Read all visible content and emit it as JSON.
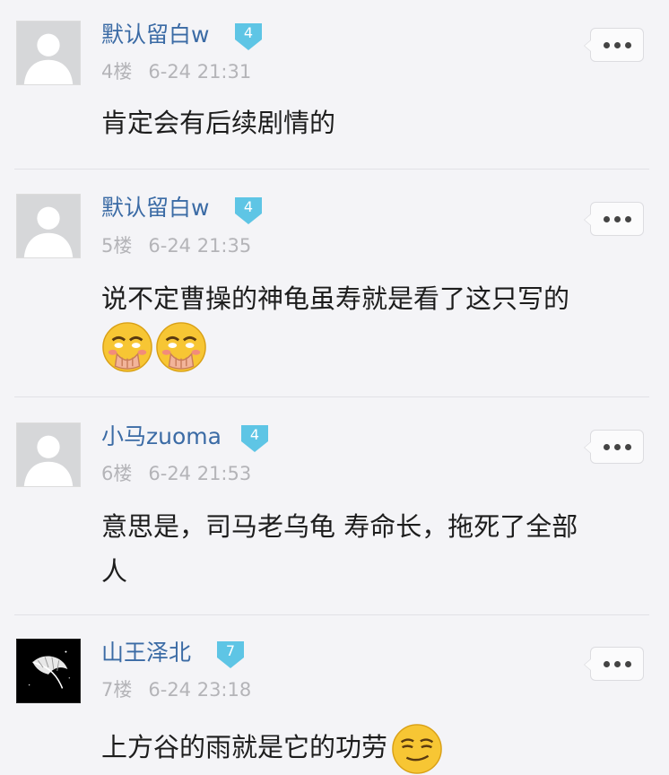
{
  "posts": [
    {
      "username": "默认留白w",
      "level": "4",
      "floor": "4楼",
      "time": "6-24 21:31",
      "content": "肯定会有后续剧情的",
      "content_line2": "",
      "emojis": []
    },
    {
      "username": "默认留白w",
      "level": "4",
      "floor": "5楼",
      "time": "6-24 21:35",
      "content": "说不定曹操的神龟虽寿就是看了这只写的",
      "content_line2": "",
      "emojis": [
        "covering-mouth-laugh-emoji",
        "covering-mouth-laugh-emoji"
      ]
    },
    {
      "username": "小马zuoma",
      "level": "4",
      "floor": "6楼",
      "time": "6-24 21:53",
      "content": "意思是，司马老乌龟 寿命长，拖死了全部",
      "content_line2": "人",
      "emojis": []
    },
    {
      "username": "山王泽北",
      "level": "7",
      "floor": "7楼",
      "time": "6-24 23:18",
      "content": "上方谷的雨就是它的功劳",
      "content_line2": "",
      "emojis": [
        "smirk-emoji"
      ]
    }
  ],
  "icons": {
    "avatar_default": "default-user-silhouette-icon",
    "avatar_custom": "white-feather-icon",
    "level_badge": "shield-level-badge-icon",
    "more": "more-options-dots-icon"
  },
  "colors": {
    "background": "#f4f4f7",
    "username": "#3b6ba5",
    "badge": "#5ec5e5",
    "meta": "#b4b4b8",
    "text": "#1d1d1d"
  }
}
